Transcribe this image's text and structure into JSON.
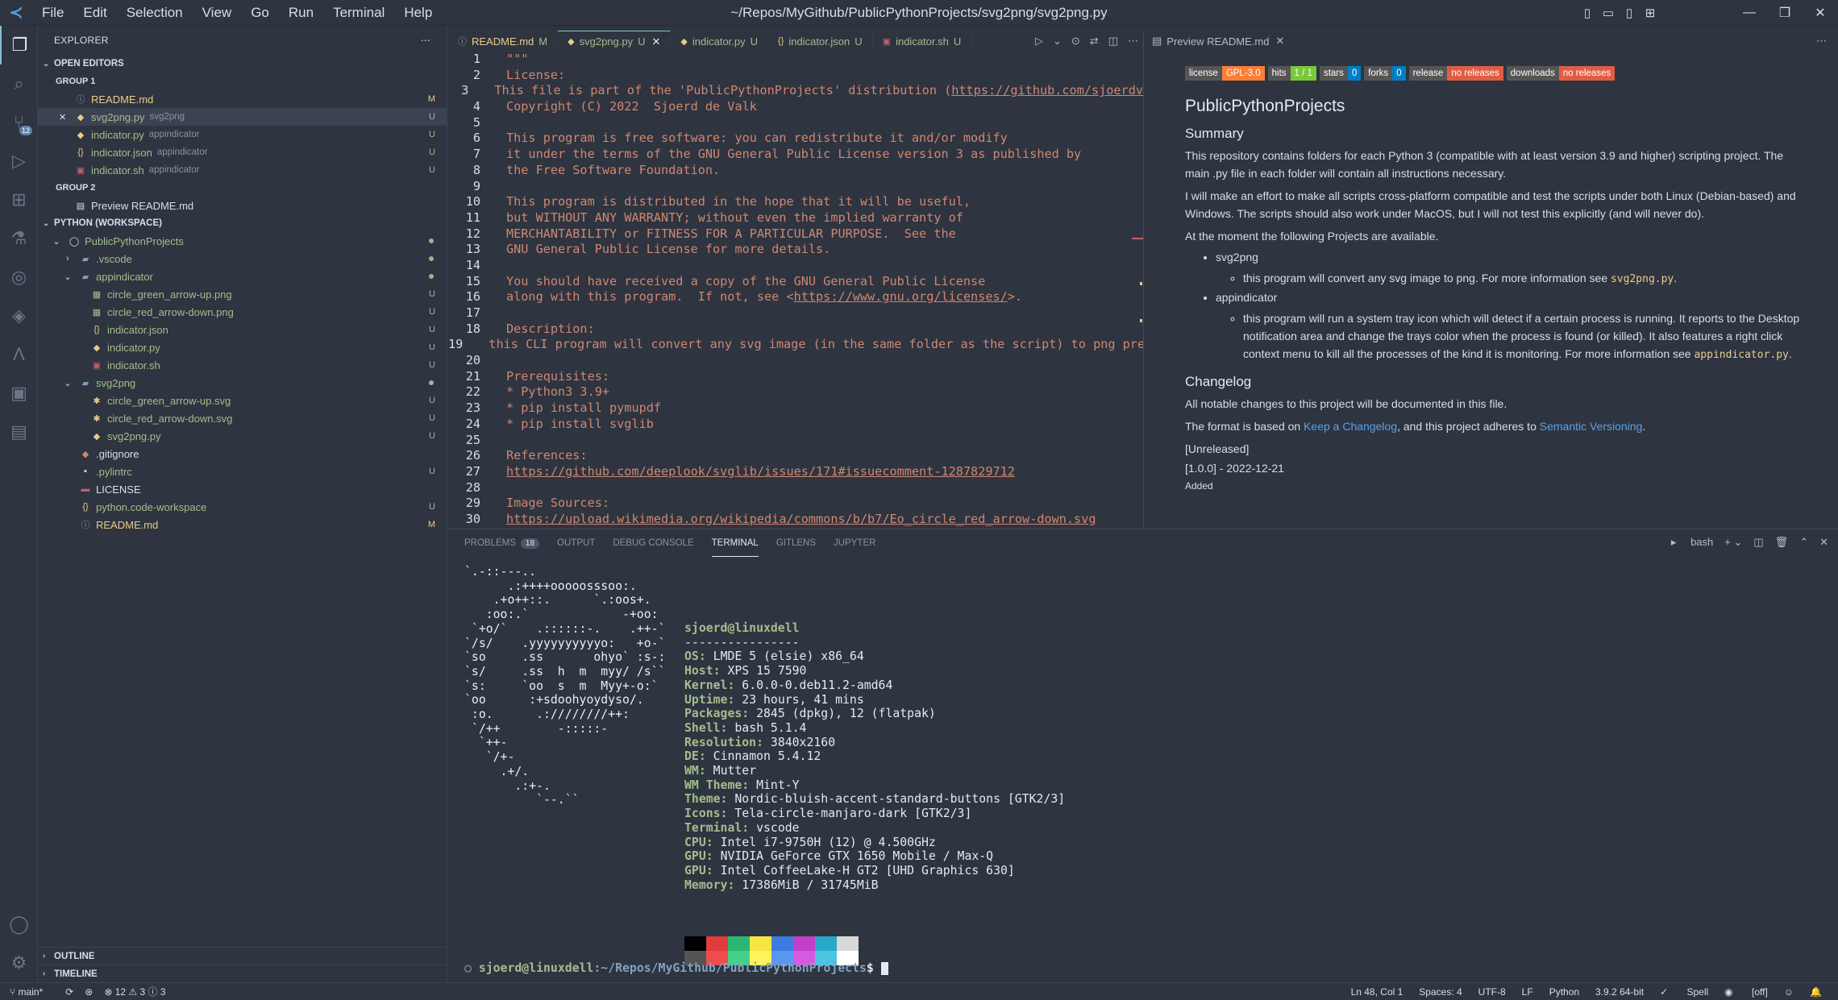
{
  "app": {
    "window_title": "~/Repos/MyGithub/PublicPythonProjects/svg2png/svg2png.py",
    "menu": [
      "File",
      "Edit",
      "Selection",
      "View",
      "Go",
      "Run",
      "Terminal",
      "Help"
    ]
  },
  "activity": {
    "scm_badge": "12"
  },
  "sidebar": {
    "title": "EXPLORER",
    "open_editors": "OPEN EDITORS",
    "group1": "GROUP 1",
    "group2": "GROUP 2",
    "open_files": [
      {
        "name": "README.md",
        "desc": "",
        "status": "M",
        "icon": "info-icon"
      },
      {
        "name": "svg2png.py",
        "desc": "svg2png",
        "status": "U",
        "icon": "python-icon"
      },
      {
        "name": "indicator.py",
        "desc": "appindicator",
        "status": "U",
        "icon": "python-icon"
      },
      {
        "name": "indicator.json",
        "desc": "appindicator",
        "status": "U",
        "icon": "json-icon"
      },
      {
        "name": "indicator.sh",
        "desc": "appindicator",
        "status": "U",
        "icon": "shell-icon"
      }
    ],
    "group2_files": [
      {
        "name": "Preview README.md"
      }
    ],
    "workspace": "PYTHON (WORKSPACE)",
    "tree": [
      {
        "name": "PublicPythonProjects",
        "depth": 0,
        "status": "dot"
      },
      {
        "name": ".vscode",
        "depth": 1,
        "status": "dot"
      },
      {
        "name": "appindicator",
        "depth": 1,
        "status": "dot"
      },
      {
        "name": "circle_green_arrow-up.png",
        "depth": 2,
        "status": "U"
      },
      {
        "name": "circle_red_arrow-down.png",
        "depth": 2,
        "status": "U"
      },
      {
        "name": "indicator.json",
        "depth": 2,
        "status": "U"
      },
      {
        "name": "indicator.py",
        "depth": 2,
        "status": "U"
      },
      {
        "name": "indicator.sh",
        "depth": 2,
        "status": "U"
      },
      {
        "name": "svg2png",
        "depth": 1,
        "status": "dot"
      },
      {
        "name": "circle_green_arrow-up.svg",
        "depth": 2,
        "status": "U"
      },
      {
        "name": "circle_red_arrow-down.svg",
        "depth": 2,
        "status": "U"
      },
      {
        "name": "svg2png.py",
        "depth": 2,
        "status": "U"
      },
      {
        "name": ".gitignore",
        "depth": 1,
        "status": ""
      },
      {
        "name": ".pylintrc",
        "depth": 1,
        "status": "U"
      },
      {
        "name": "LICENSE",
        "depth": 1,
        "status": ""
      },
      {
        "name": "python.code-workspace",
        "depth": 1,
        "status": "U"
      },
      {
        "name": "README.md",
        "depth": 1,
        "status": "M"
      }
    ],
    "outline": "OUTLINE",
    "timeline": "TIMELINE"
  },
  "tabs": [
    {
      "label": "README.md",
      "mod": "M"
    },
    {
      "label": "svg2png.py",
      "mod": "U"
    },
    {
      "label": "indicator.py",
      "mod": "U"
    },
    {
      "label": "indicator.json",
      "mod": "U"
    },
    {
      "label": "indicator.sh",
      "mod": "U"
    }
  ],
  "preview_tab": "Preview README.md",
  "code": [
    "\"\"\"",
    "License:",
    "This file is part of the 'PublicPythonProjects' distribution (https://github.com/sjoerdv",
    "Copyright (C) 2022  Sjoerd de Valk",
    "",
    "This program is free software: you can redistribute it and/or modify",
    "it under the terms of the GNU General Public License version 3 as published by",
    "the Free Software Foundation.",
    "",
    "This program is distributed in the hope that it will be useful,",
    "but WITHOUT ANY WARRANTY; without even the implied warranty of",
    "MERCHANTABILITY or FITNESS FOR A PARTICULAR PURPOSE.  See the",
    "GNU General Public License for more details.",
    "",
    "You should have received a copy of the GNU General Public License",
    "along with this program.  If not, see <https://www.gnu.org/licenses/>.",
    "",
    "Description:",
    "this CLI program will convert any svg image (in the same folder as the script) to png pre",
    "",
    "Prerequisites:",
    "* Python3 3.9+",
    "* pip install pymupdf",
    "* pip install svglib",
    "",
    "References:",
    "https://github.com/deeplook/svglib/issues/171#issuecomment-1287829712",
    "",
    "Image Sources:",
    "https://upload.wikimedia.org/wikipedia/commons/b/b7/Eo_circle_red_arrow-down.svg"
  ],
  "preview": {
    "badges": [
      {
        "k": "license",
        "v": "GPL-3.0",
        "c": "#fe7d37"
      },
      {
        "k": "hits",
        "v": "1 / 1",
        "c": "#79c83d"
      },
      {
        "k": "stars",
        "v": "0",
        "c": "#007ec6"
      },
      {
        "k": "forks",
        "v": "0",
        "c": "#007ec6"
      },
      {
        "k": "release",
        "v": "no releases",
        "c": "#e05d44"
      },
      {
        "k": "downloads",
        "v": "no releases",
        "c": "#e05d44"
      }
    ],
    "h1": "PublicPythonProjects",
    "summary_h": "Summary",
    "p1": "This repository contains folders for each Python 3 (compatible with at least version 3.9 and higher) scripting project. The main .py file in each folder will contain all instructions necessary.",
    "p2": "I will make an effort to make all scripts cross-platform compatible and test the scripts under both Linux (Debian-based) and Windows. The scripts should also work under MacOS, but I will not test this explicitly (and will never do).",
    "p3": "At the moment the following Projects are available.",
    "li1": "svg2png",
    "li1a": "this program will convert any svg image to png. For more information see ",
    "li1a_code": "svg2png.py",
    "li2": "appindicator",
    "li2a": "this program will run a system tray icon which will detect if a certain process is running. It reports to the Desktop notification area and change the trays color when the process is found (or killed). It also features a right click context menu to kill all the processes of the kind it is monitoring. For more information see ",
    "li2a_code": "appindicator.py",
    "changelog_h": "Changelog",
    "c1": "All notable changes to this project will be documented in this file.",
    "c2_pre": "The format is based on ",
    "c2_link1": "Keep a Changelog",
    "c2_mid": ", and this project adheres to ",
    "c2_link2": "Semantic Versioning",
    "c2_post": ".",
    "unreleased": "[Unreleased]",
    "version": "[1.0.0] - 2022-12-21",
    "added": "Added"
  },
  "panel": {
    "tabs": [
      "PROBLEMS",
      "OUTPUT",
      "DEBUG CONSOLE",
      "TERMINAL",
      "GITLENS",
      "JUPYTER"
    ],
    "problems_count": "18",
    "shell": "bash"
  },
  "terminal": {
    "ascii": [
      "`.-::---..",
      "      .:++++ooooosssoo:.",
      "    .+o++::.      `.:oos+.",
      "   :oo:.`             -+oo:",
      " `+o/`    .::::::-.    .++-`",
      "`/s/    .yyyyyyyyyyo:   +o-`",
      "`so     .ss       ohyo` :s-:",
      "`s/     .ss  h  m  myy/ /s``",
      "`s:     `oo  s  m  Myy+-o:`",
      "`oo      :+sdoohyoydyso/.",
      " :o.      .:////////++:",
      " `/++        -:::::-",
      "  `++-",
      "   `/+-",
      "     .+/.",
      "       .:+-.",
      "          `--.``"
    ],
    "user_host": "sjoerd@linuxdell",
    "sep": "----------------",
    "info": [
      {
        "k": "OS",
        "v": "LMDE 5 (elsie) x86_64"
      },
      {
        "k": "Host",
        "v": "XPS 15 7590"
      },
      {
        "k": "Kernel",
        "v": "6.0.0-0.deb11.2-amd64"
      },
      {
        "k": "Uptime",
        "v": "23 hours, 41 mins"
      },
      {
        "k": "Packages",
        "v": "2845 (dpkg), 12 (flatpak)"
      },
      {
        "k": "Shell",
        "v": "bash 5.1.4"
      },
      {
        "k": "Resolution",
        "v": "3840x2160"
      },
      {
        "k": "DE",
        "v": "Cinnamon 5.4.12"
      },
      {
        "k": "WM",
        "v": "Mutter"
      },
      {
        "k": "WM Theme",
        "v": "Mint-Y"
      },
      {
        "k": "Theme",
        "v": "Nordic-bluish-accent-standard-buttons [GTK2/3]"
      },
      {
        "k": "Icons",
        "v": "Tela-circle-manjaro-dark [GTK2/3]"
      },
      {
        "k": "Terminal",
        "v": "vscode"
      },
      {
        "k": "CPU",
        "v": "Intel i7-9750H (12) @ 4.500GHz"
      },
      {
        "k": "GPU",
        "v": "NVIDIA GeForce GTX 1650 Mobile / Max-Q"
      },
      {
        "k": "GPU",
        "v": "Intel CoffeeLake-H GT2 [UHD Graphics 630]"
      },
      {
        "k": "Memory",
        "v": "17386MiB / 31745MiB"
      }
    ],
    "swatches": [
      "#000000",
      "#e03c3c",
      "#2bb673",
      "#f5e642",
      "#3e7be0",
      "#c13fc8",
      "#2aa8c8",
      "#d8d8d8",
      "#545454",
      "#ee4d4d",
      "#43d18a",
      "#fff35c",
      "#5b95f0",
      "#d65ae0",
      "#4cc5e0",
      "#ffffff"
    ],
    "prompt_user": "sjoerd@linuxdell",
    "prompt_path": ":~/Repos/MyGithub/PublicPythonProjects",
    "prompt_sym": "$ "
  },
  "status": {
    "branch": "main*",
    "problems": "⊗ 12 ⚠ 3 ⓘ 3",
    "position": "Ln 48, Col 1",
    "spaces": "Spaces: 4",
    "encoding": "UTF-8",
    "eol": "LF",
    "language": "Python",
    "interpreter": "3.9.2 64-bit",
    "spell": "Spell",
    "off": "[off]"
  }
}
